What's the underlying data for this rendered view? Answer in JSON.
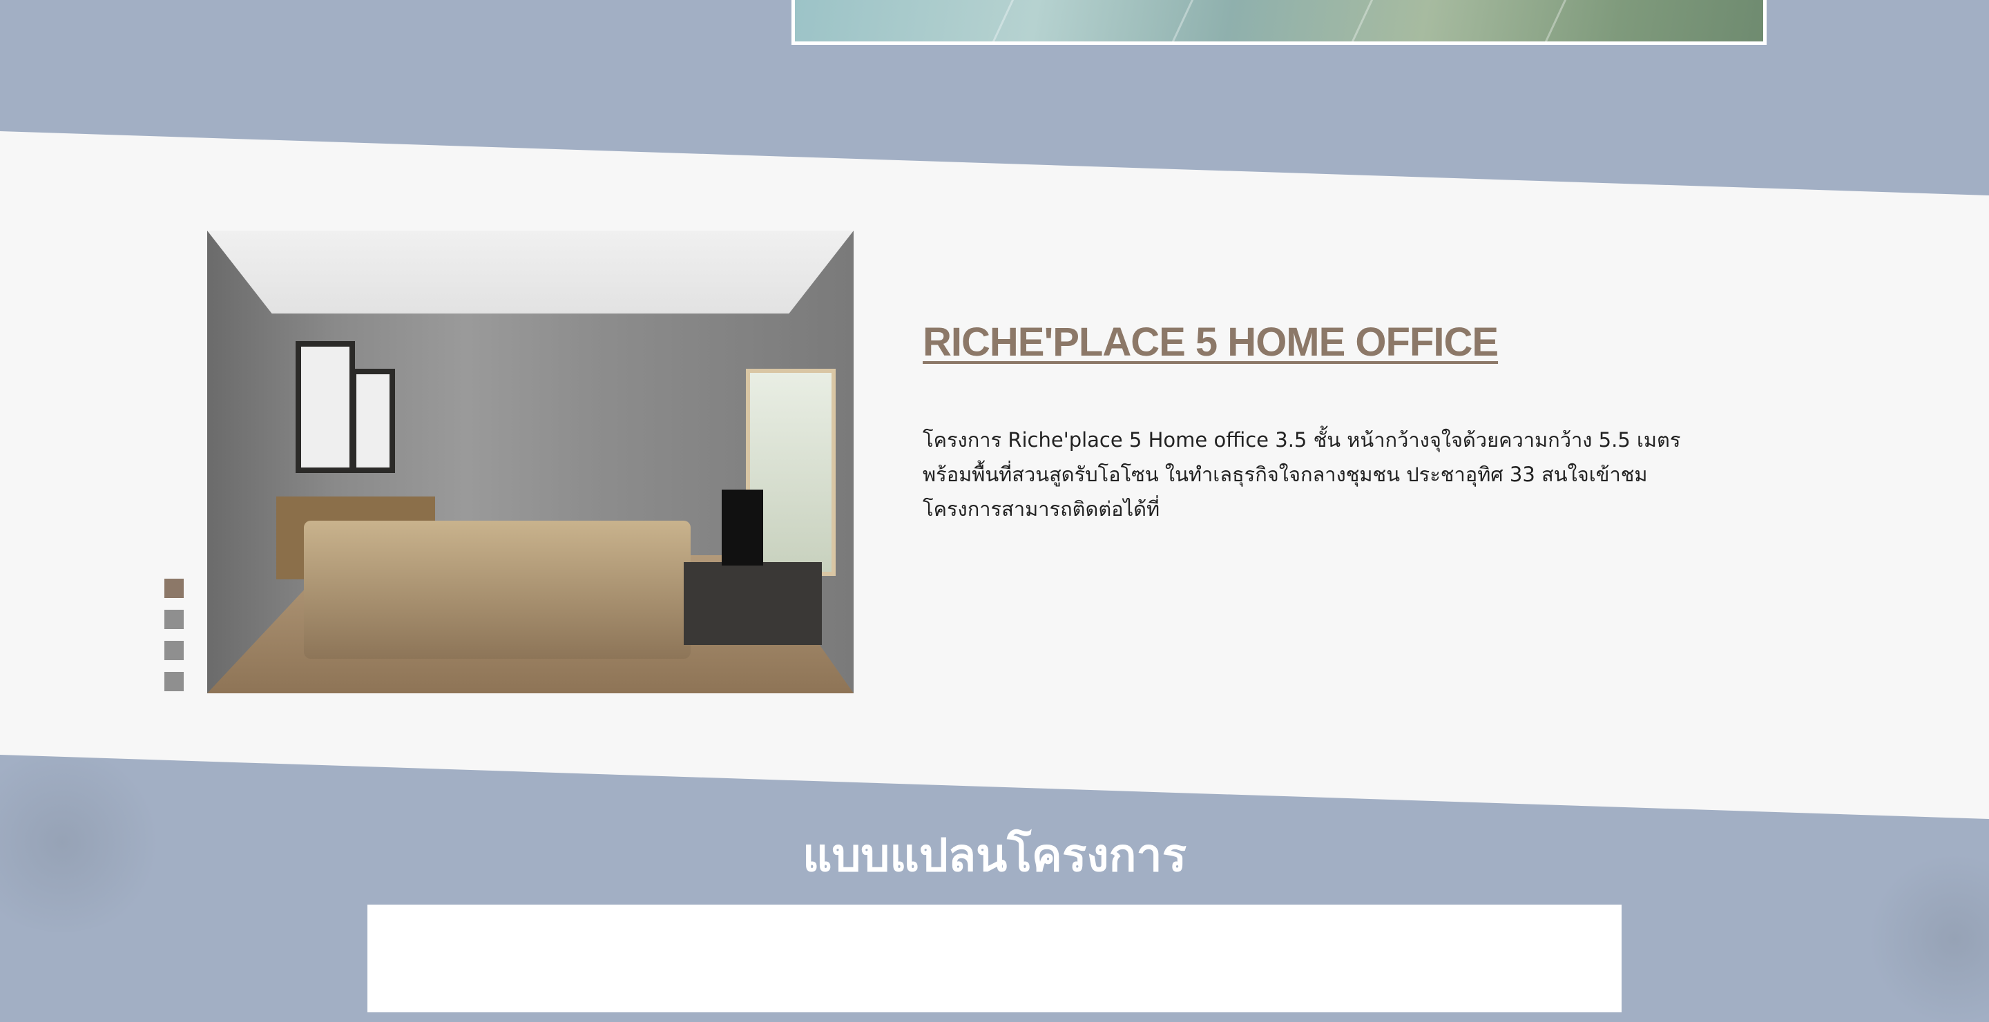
{
  "project": {
    "title": "RICHE'PLACE 5 HOME OFFICE",
    "description": "โครงการ Riche'place 5 Home office  3.5 ชั้น หน้ากว้างจุใจด้วยความกว้าง 5.5 เมตร พร้อมพื้นที่สวนสูดรับโอโซน ในทำเลธุรกิจใจกลางชุมชน ประชาอุทิศ 33 สนใจเข้าชมโครงการสามารถติดต่อได้ที่"
  },
  "slider": {
    "image_icon": "bedroom-interior-image",
    "slide_count": 4,
    "active_index": 0
  },
  "floor_plan": {
    "heading": "แบบแปลนโครงการ"
  },
  "colors": {
    "background_blue": "#a2afc4",
    "band_white": "#f7f7f7",
    "accent_brown": "#8c7868",
    "pager_inactive": "#8f8f8f",
    "text_dark": "#222222"
  }
}
